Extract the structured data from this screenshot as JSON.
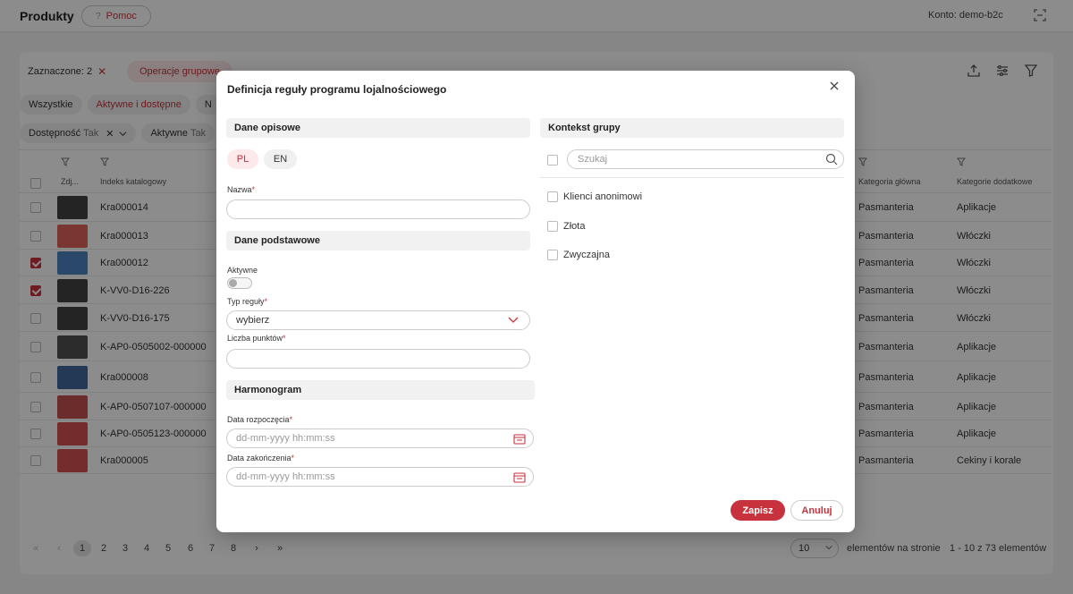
{
  "app": {
    "title": "Produkty",
    "help_label": "Pomoc",
    "help_icon": "?",
    "account": "Konto: demo-b2c"
  },
  "toolbar": {
    "selected_label": "Zaznaczone: 2",
    "clear_icon": "✕",
    "group_ops": "Operacje grupowe"
  },
  "status_tabs": [
    "Wszystkie",
    "Aktywne i dostępne",
    "N"
  ],
  "filters": [
    {
      "name": "Dostępność",
      "value": "Tak"
    },
    {
      "name": "Aktywne",
      "value": "Tak"
    }
  ],
  "table": {
    "headers": {
      "photo": "Zdj...",
      "index": "Indeks katalogowy",
      "main_category": "Kategoria główna",
      "extra_categories": "Kategorie dodatkowe"
    },
    "rows": [
      {
        "checked": false,
        "index": "Kra000014",
        "main": "Pasmanteria",
        "extra": "Aplikacje",
        "thumb": "#222"
      },
      {
        "checked": false,
        "index": "Kra000013",
        "main": "Pasmanteria",
        "extra": "Włóczki",
        "thumb": "#d94a3d"
      },
      {
        "checked": true,
        "index": "Kra000012",
        "main": "Pasmanteria",
        "extra": "Włóczki",
        "thumb": "#2f6fb5"
      },
      {
        "checked": true,
        "index": "K-VV0-D16-226",
        "main": "Pasmanteria",
        "extra": "Włóczki",
        "thumb": "#222"
      },
      {
        "checked": false,
        "index": "K-VV0-D16-175",
        "main": "Pasmanteria",
        "extra": "Włóczki",
        "thumb": "#222"
      },
      {
        "checked": false,
        "index": "K-AP0-0505002-000000",
        "main": "Pasmanteria",
        "extra": "Aplikacje",
        "thumb": "#333"
      },
      {
        "checked": false,
        "index": "Kra000008",
        "main": "Pasmanteria",
        "extra": "Aplikacje",
        "thumb": "#1f4e8c"
      },
      {
        "checked": false,
        "index": "K-AP0-0507107-000000",
        "main": "Pasmanteria",
        "extra": "Aplikacje",
        "thumb": "#b33"
      },
      {
        "checked": false,
        "index": "K-AP0-0505123-000000",
        "main": "Pasmanteria",
        "extra": "Aplikacje",
        "thumb": "#c33"
      },
      {
        "checked": false,
        "index": "Kra000005",
        "main": "Pasmanteria",
        "extra": "Cekiny i korale",
        "thumb": "#c33"
      }
    ]
  },
  "pager": {
    "first": "«",
    "prev": "‹",
    "pages": [
      "1",
      "2",
      "3",
      "4",
      "5",
      "6",
      "7",
      "8"
    ],
    "current": "1",
    "next": "›",
    "last": "»",
    "per_page": "10",
    "per_page_label": "elementów na stronie",
    "range": "1 - 10 z 73 elementów"
  },
  "modal": {
    "title": "Definicja reguły programu lojalnościowego",
    "sections": {
      "descriptive": "Dane opisowe",
      "basic": "Dane podstawowe",
      "schedule": "Harmonogram",
      "group_context": "Kontekst grupy"
    },
    "langs": [
      "PL",
      "EN"
    ],
    "fields": {
      "name_label": "Nazwa",
      "name_value": "",
      "active_label": "Aktywne",
      "active": false,
      "rule_type_label": "Typ reguły",
      "rule_type_value": "wybierz",
      "points_label": "Liczba punktów",
      "points_value": "",
      "start_label": "Data rozpoczęcia",
      "start_placeholder": "dd-mm-yyyy hh:mm:ss",
      "end_label": "Data zakończenia",
      "end_placeholder": "dd-mm-yyyy hh:mm:ss",
      "required_mark": "*"
    },
    "group_search_placeholder": "Szukaj",
    "groups": [
      "Klienci anonimowi",
      "Złota",
      "Zwyczajna"
    ],
    "save_label": "Zapisz",
    "cancel_label": "Anuluj"
  },
  "colors": {
    "accent": "#c8323c",
    "accent_light": "#fde8ea"
  }
}
